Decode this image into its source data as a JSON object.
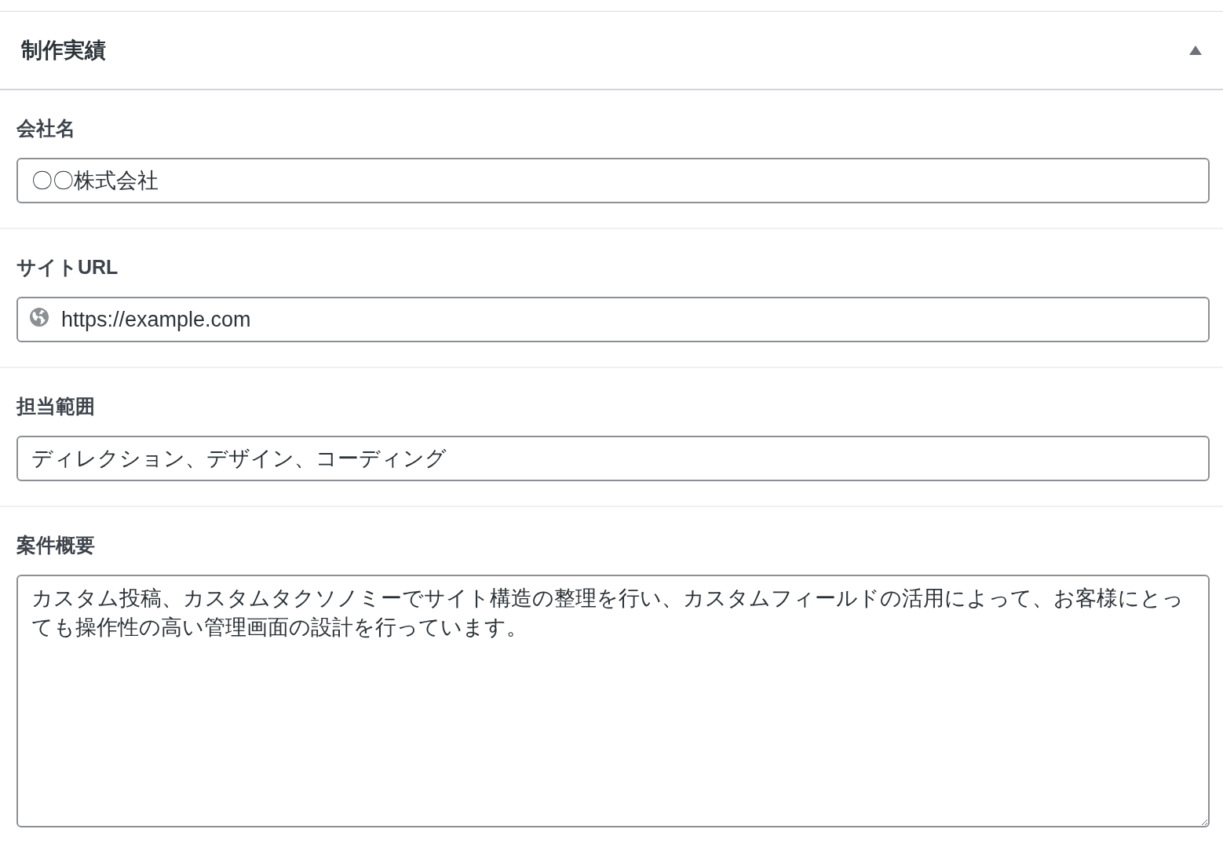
{
  "panel": {
    "title": "制作実績",
    "expanded": true
  },
  "fields": [
    {
      "kind": "text",
      "label": "会社名",
      "value": "〇〇株式会社"
    },
    {
      "kind": "url",
      "label": "サイトURL",
      "value": "https://example.com"
    },
    {
      "kind": "text",
      "label": "担当範囲",
      "value": "ディレクション、デザイン、コーディング"
    },
    {
      "kind": "textarea",
      "label": "案件概要",
      "value": "カスタム投稿、カスタムタクソノミーでサイト構造の整理を行い、カスタムフィールドの活用によって、お客様にとっても操作性の高い管理画面の設計を行っています。"
    }
  ]
}
